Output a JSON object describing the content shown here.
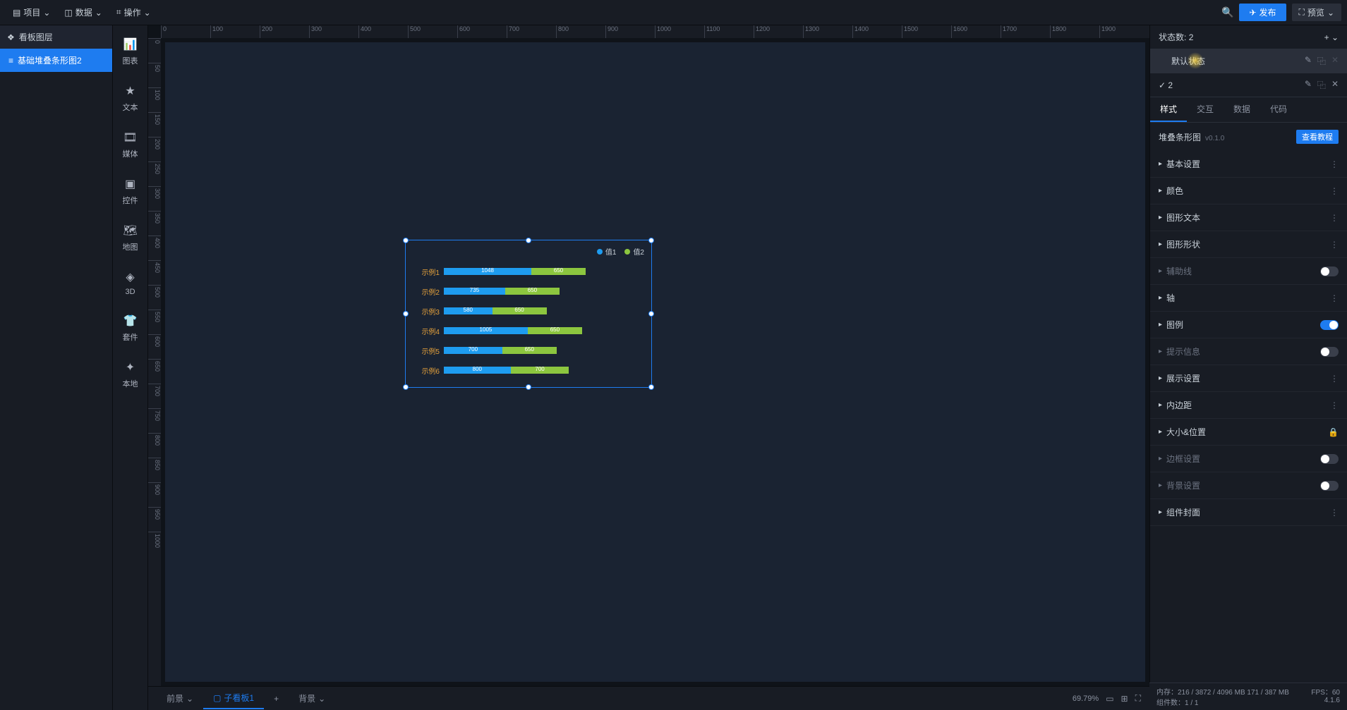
{
  "toolbar": {
    "project": "项目",
    "data": "数据",
    "operation": "操作",
    "publish": "发布",
    "preview": "预览"
  },
  "leftPanel": {
    "title": "看板图层",
    "layerItem": "基础堆叠条形图2"
  },
  "palette": [
    {
      "icon": "📊",
      "label": "图表"
    },
    {
      "icon": "★",
      "label": "文本"
    },
    {
      "icon": "🎞",
      "label": "媒体"
    },
    {
      "icon": "▣",
      "label": "控件"
    },
    {
      "icon": "🗺",
      "label": "地图"
    },
    {
      "icon": "◈",
      "label": "3D"
    },
    {
      "icon": "👕",
      "label": "套件"
    },
    {
      "icon": "✦",
      "label": "本地"
    }
  ],
  "bottomTabs": {
    "front": "前景",
    "sub": "子看板1",
    "back": "背景",
    "zoom": "69.79%"
  },
  "rightPanel": {
    "stateCountLabel": "状态数:",
    "stateCount": "2",
    "state1": "默认状态",
    "state2": "2",
    "tabs": {
      "style": "样式",
      "interact": "交互",
      "data": "数据",
      "code": "代码"
    },
    "compName": "堆叠条形图",
    "compVer": "v0.1.0",
    "tutorial": "查看教程",
    "sections": {
      "basic": "基本设置",
      "color": "颜色",
      "text": "图形文本",
      "shape": "图形形状",
      "guide": "辅助线",
      "axis": "轴",
      "legend": "图例",
      "tooltip": "提示信息",
      "display": "展示设置",
      "padding": "内边距",
      "size": "大小&位置",
      "border": "边框设置",
      "background": "背景设置",
      "cover": "组件封面"
    }
  },
  "status": {
    "mem": "内存：216 / 3872 / 4096 MB 171 / 387 MB",
    "fps": "FPS：60",
    "comp": "组件数：1 / 1",
    "ver": "4.1.6"
  },
  "chart_data": {
    "type": "bar",
    "orientation": "horizontal",
    "stacked": true,
    "title": "",
    "legend": [
      "值1",
      "值2"
    ],
    "colors": {
      "值1": "#1e9cf0",
      "值2": "#8cc63f"
    },
    "categories": [
      "示例1",
      "示例2",
      "示例3",
      "示例4",
      "示例5",
      "示例6"
    ],
    "series": [
      {
        "name": "值1",
        "values": [
          1048,
          735,
          580,
          1005,
          700,
          800
        ]
      },
      {
        "name": "值2",
        "values": [
          650,
          650,
          650,
          650,
          650,
          700
        ]
      }
    ],
    "xlim": [
      0,
      2400
    ]
  }
}
